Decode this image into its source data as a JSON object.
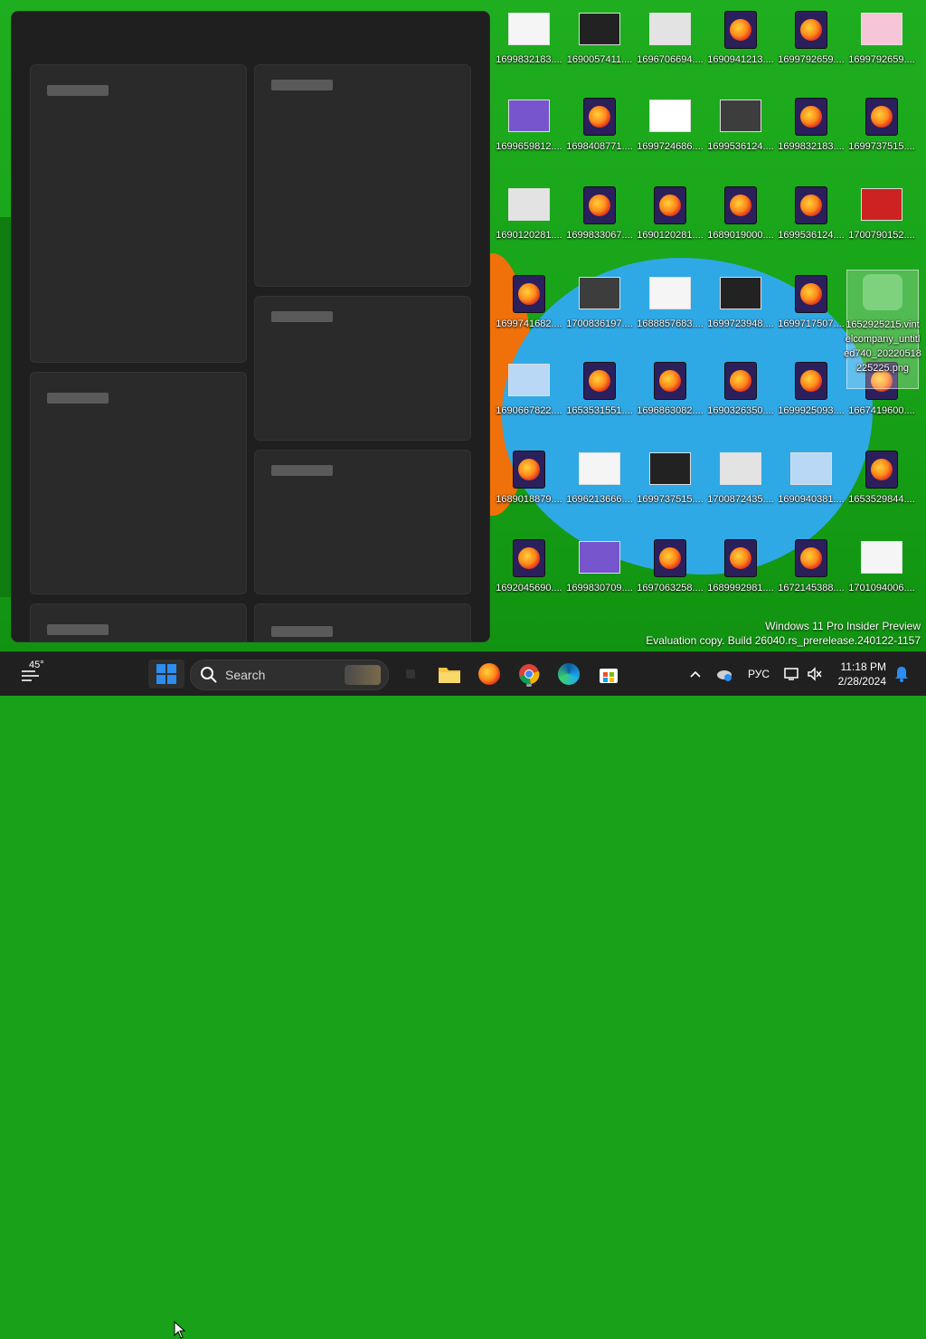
{
  "desktop": {
    "icons": [
      {
        "label": "1699832183....",
        "kind": "image"
      },
      {
        "label": "1690057411....",
        "kind": "image"
      },
      {
        "label": "1696706694....",
        "kind": "image"
      },
      {
        "label": "1690941213....",
        "kind": "firefox"
      },
      {
        "label": "1699792659....",
        "kind": "firefox"
      },
      {
        "label": "1699792659....",
        "kind": "image"
      },
      {
        "label": "1699659812....",
        "kind": "image"
      },
      {
        "label": "1698408771....",
        "kind": "firefox"
      },
      {
        "label": "1699724686....",
        "kind": "image"
      },
      {
        "label": "1699536124....",
        "kind": "image"
      },
      {
        "label": "1699832183....",
        "kind": "firefox"
      },
      {
        "label": "1699737515....",
        "kind": "firefox"
      },
      {
        "label": "1690120281....",
        "kind": "image"
      },
      {
        "label": "1699833067....",
        "kind": "firefox"
      },
      {
        "label": "1690120281....",
        "kind": "firefox"
      },
      {
        "label": "1689019000....",
        "kind": "firefox"
      },
      {
        "label": "1699536124....",
        "kind": "firefox"
      },
      {
        "label": "1700790152....",
        "kind": "image"
      },
      {
        "label": "1699741682....",
        "kind": "firefox"
      },
      {
        "label": "1700836197....",
        "kind": "image"
      },
      {
        "label": "1688857683....",
        "kind": "image"
      },
      {
        "label": "1699723948....",
        "kind": "image"
      },
      {
        "label": "1699717507....",
        "kind": "firefox"
      },
      {
        "label": "1690667822....",
        "kind": "image"
      },
      {
        "label": "1653531551....",
        "kind": "firefox"
      },
      {
        "label": "1696863082....",
        "kind": "firefox"
      },
      {
        "label": "1690326350....",
        "kind": "firefox"
      },
      {
        "label": "1699925093....",
        "kind": "firefox"
      },
      {
        "label": "1667419600....",
        "kind": "firefox"
      },
      {
        "label": "1689018879....",
        "kind": "firefox"
      },
      {
        "label": "1696213666....",
        "kind": "image"
      },
      {
        "label": "1699737515....",
        "kind": "image"
      },
      {
        "label": "1700872435....",
        "kind": "image"
      },
      {
        "label": "1690940381....",
        "kind": "image"
      },
      {
        "label": "1653529844....",
        "kind": "firefox"
      },
      {
        "label": "1692045690....",
        "kind": "firefox"
      },
      {
        "label": "1699830709....",
        "kind": "image"
      },
      {
        "label": "1697063258....",
        "kind": "firefox"
      },
      {
        "label": "1689992981....",
        "kind": "firefox"
      },
      {
        "label": "1672145388....",
        "kind": "firefox"
      },
      {
        "label": "1701094006....",
        "kind": "image"
      }
    ],
    "selected_icon": {
      "label": "1652925215.vintelcompany_untitled740_20220518225225.png"
    },
    "watermark": {
      "line1": "Windows 11 Pro Insider Preview",
      "line2": "Evaluation copy. Build 26040.rs_prerelease.240122-1157"
    }
  },
  "taskbar": {
    "weather_temp": "45°",
    "search_placeholder": "Search",
    "language": "РУС",
    "time": "11:18 PM",
    "date": "2/28/2024",
    "apps": [
      "file-explorer-icon",
      "firefox-icon",
      "chrome-icon",
      "edge-icon",
      "store-icon"
    ]
  },
  "colors": {
    "taskbar": "#202020",
    "panel": "#1f1f1f",
    "desktop": "#1aa11a"
  }
}
